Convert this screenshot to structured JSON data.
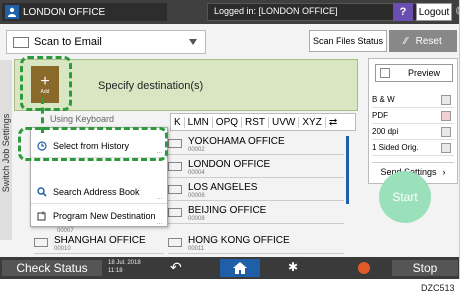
{
  "topbar": {
    "user_title": "LONDON OFFICE",
    "logged_in": "Logged in: [LONDON OFFICE]",
    "help": "?",
    "logout": "Logout",
    "moon": "☾"
  },
  "mode": {
    "label": "Scan to Email"
  },
  "toolbar": {
    "scan_status": "Scan Files Status",
    "reset": "Reset"
  },
  "side_tab": "Switch Job Settings",
  "destination": {
    "add_label": "Add",
    "add_symbol": "+",
    "specify": "Specify destination(s)",
    "keyboard_hint": "Using Keyboard"
  },
  "index_tabs": [
    "K",
    "LMN",
    "OPQ",
    "RST",
    "UVW",
    "XYZ",
    "⇄"
  ],
  "dest_list": [
    {
      "name": "YOKOHAMA OFFICE",
      "num": "00002"
    },
    {
      "name": "LONDON OFFICE",
      "num": "00004"
    },
    {
      "name": "LOS ANGELES",
      "num": "00006"
    },
    {
      "name": "BEIJING OFFICE",
      "num": "00008"
    },
    {
      "name": "HONG KONG OFFICE",
      "num": "00011"
    },
    {
      "name": "SHANGHAI OFFICE",
      "num": "00010"
    }
  ],
  "popup_menu": [
    {
      "label": "Select from History",
      "icon": "clock-icon"
    },
    {
      "label": "Search Address Book",
      "icon": "search-icon"
    },
    {
      "label": "Program New Destination",
      "icon": "program-icon"
    }
  ],
  "popup_extra_num": "00007",
  "right_panel": {
    "preview": "Preview",
    "settings": [
      "B & W",
      "PDF",
      "200 dpi",
      "1 Sided Orig."
    ],
    "send_settings": "Send Settings",
    "start": "Start"
  },
  "bottombar": {
    "check_status": "Check Status",
    "date": "18 Jul. 2018",
    "time": "11:18",
    "stop": "Stop"
  },
  "figure_code": "DZC513",
  "colors": {
    "accent": "#1f5fa8",
    "callout": "#2e9a3e",
    "start": "#9ae0bb",
    "add": "#8a6a2a"
  }
}
